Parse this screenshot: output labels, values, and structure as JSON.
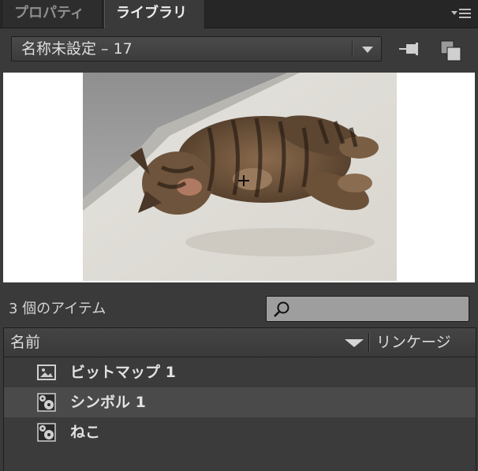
{
  "tabs": [
    {
      "label": "プロパティ",
      "active": false
    },
    {
      "label": "ライブラリ",
      "active": true
    }
  ],
  "document_select": {
    "value": "名称未設定 – 17"
  },
  "library": {
    "item_count_label": "3 個のアイテム",
    "search": {
      "value": "",
      "placeholder": ""
    },
    "columns": {
      "name": "名前",
      "linkage": "リンケージ"
    },
    "items": [
      {
        "label": "ビットマップ 1",
        "icon": "bitmap-icon",
        "selected": false
      },
      {
        "label": "シンボル 1",
        "icon": "movie-clip-icon",
        "selected": true
      },
      {
        "label": "ねこ",
        "icon": "movie-clip-icon",
        "selected": false
      }
    ]
  },
  "colors": {
    "panel_bg": "#3a3a3a",
    "tabbar_bg": "#262626",
    "selected_row": "#4a4a4a",
    "search_bg": "#9e9e9e",
    "preview_bg": "#ffffff"
  }
}
